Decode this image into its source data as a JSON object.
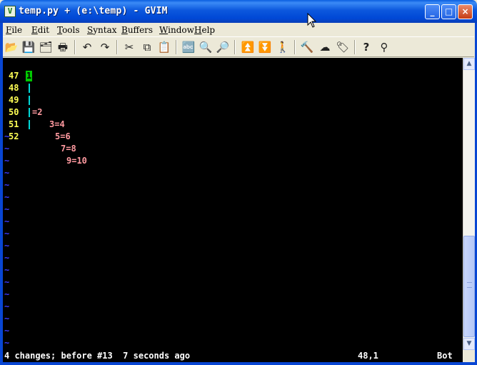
{
  "window": {
    "title": "temp.py + (e:\\temp) - GVIM",
    "app_icon": "vim-icon",
    "controls": [
      "_",
      "□",
      "×"
    ]
  },
  "menubar": [
    {
      "label": "File",
      "underline": "F",
      "rest": "ile"
    },
    {
      "label": "Edit",
      "underline": "E",
      "rest": "dit"
    },
    {
      "label": "Tools",
      "underline": "T",
      "rest": "ools"
    },
    {
      "label": "Syntax",
      "underline": "S",
      "rest": "yntax"
    },
    {
      "label": "Buffers",
      "underline": "B",
      "rest": "uffers"
    },
    {
      "label": "Window",
      "underline": "W",
      "rest": "indow"
    },
    {
      "label": "Help",
      "underline": "H",
      "rest": "elp"
    }
  ],
  "toolbar": [
    {
      "name": "open-icon",
      "glyph": "📂"
    },
    {
      "name": "save-icon",
      "glyph": "💾"
    },
    {
      "name": "save-all-icon",
      "glyph": "🗂"
    },
    {
      "name": "print-icon",
      "glyph": "🖶"
    },
    {
      "name": "undo-icon",
      "glyph": "↶"
    },
    {
      "name": "redo-icon",
      "glyph": "↷"
    },
    {
      "name": "cut-icon",
      "glyph": "✂"
    },
    {
      "name": "copy-icon",
      "glyph": "⧉"
    },
    {
      "name": "paste-icon",
      "glyph": "📋"
    },
    {
      "name": "find-replace-icon",
      "glyph": "🔤"
    },
    {
      "name": "find-next-icon",
      "glyph": "🔍"
    },
    {
      "name": "find-prev-icon",
      "glyph": "🔎"
    },
    {
      "name": "load-session-icon",
      "glyph": "⏫"
    },
    {
      "name": "save-session-icon",
      "glyph": "⏬"
    },
    {
      "name": "run-script-icon",
      "glyph": "🚶"
    },
    {
      "name": "make-icon",
      "glyph": "🔨"
    },
    {
      "name": "shell-icon",
      "glyph": "☁"
    },
    {
      "name": "ctags-icon",
      "glyph": "🏷"
    },
    {
      "name": "help-icon",
      "glyph": "?"
    },
    {
      "name": "find-help-icon",
      "glyph": "⚲"
    }
  ],
  "editor": {
    "lines": [
      {
        "num": "47",
        "bar": false,
        "code": ""
      },
      {
        "num": "48",
        "bar": false,
        "cursor": "1",
        "code": "=2"
      },
      {
        "num": "49",
        "bar": true,
        "code": "3=4"
      },
      {
        "num": "50",
        "bar": true,
        "code": "5=6"
      },
      {
        "num": "51",
        "bar": true,
        "code": "7=8"
      },
      {
        "num": "52",
        "bar": true,
        "code": "9=10"
      }
    ],
    "tilde": "~",
    "colors": {
      "line_number": "#ffff55",
      "code": "#ff9aa0",
      "indent_bar": "#00d7d7",
      "cursor": "#00c800",
      "tilde": "#3b3bff",
      "background": "#000000"
    }
  },
  "scrollbar": {
    "up": "▲",
    "down": "▼",
    "position": 0.9
  },
  "status": {
    "message": "4 changes; before #13  7 seconds ago",
    "position": "48,1",
    "percent": "Bot"
  }
}
